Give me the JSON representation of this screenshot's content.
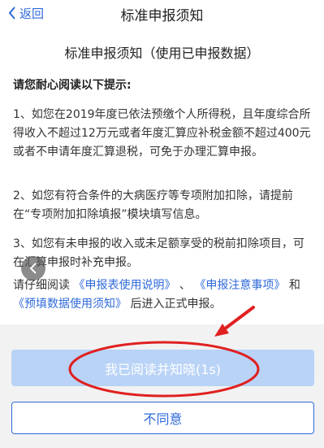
{
  "nav": {
    "back_label": "返回",
    "title": "标准申报须知"
  },
  "doc": {
    "title": "标准申报须知（使用已申报数据）",
    "hint": "请您耐心阅读以下提示:",
    "item1": "1、如您在2019年度已依法预缴个人所得税，且年度综合所得收入不超过12万元或者年度汇算应补税金额不超过400元或者不申请年度汇算退税，可免于办理汇算申报。",
    "item2": "2、如您有符合条件的大病医疗等专项附加扣除，请提前在“专项附加扣除填报”模块填写信息。",
    "item3": "3、如您有未申报的收入或未足额享受的税前扣除项目，可在汇算申报时补充申报。",
    "read_prefix": "请仔细阅读",
    "link1": "《申报表使用说明》",
    "sep1": "、",
    "link2": "《申报注意事项》",
    "and": "和",
    "link3": "《预填数据使用须知》",
    "read_suffix": "后进入正式申报。"
  },
  "buttons": {
    "agree_label": "我已阅读并知晓(1s)",
    "disagree_label": "不同意"
  },
  "colors": {
    "accent": "#2f6ad9",
    "agree_disabled": "#b9d3f7",
    "annotation_red": "#e02020",
    "footer_bg": "#f2f2f2"
  },
  "icons": {
    "back": "chevron-left-icon",
    "float_back": "floating-back-icon",
    "annotation_arrow": "red-arrow-annotation",
    "annotation_circle": "red-circle-annotation"
  }
}
